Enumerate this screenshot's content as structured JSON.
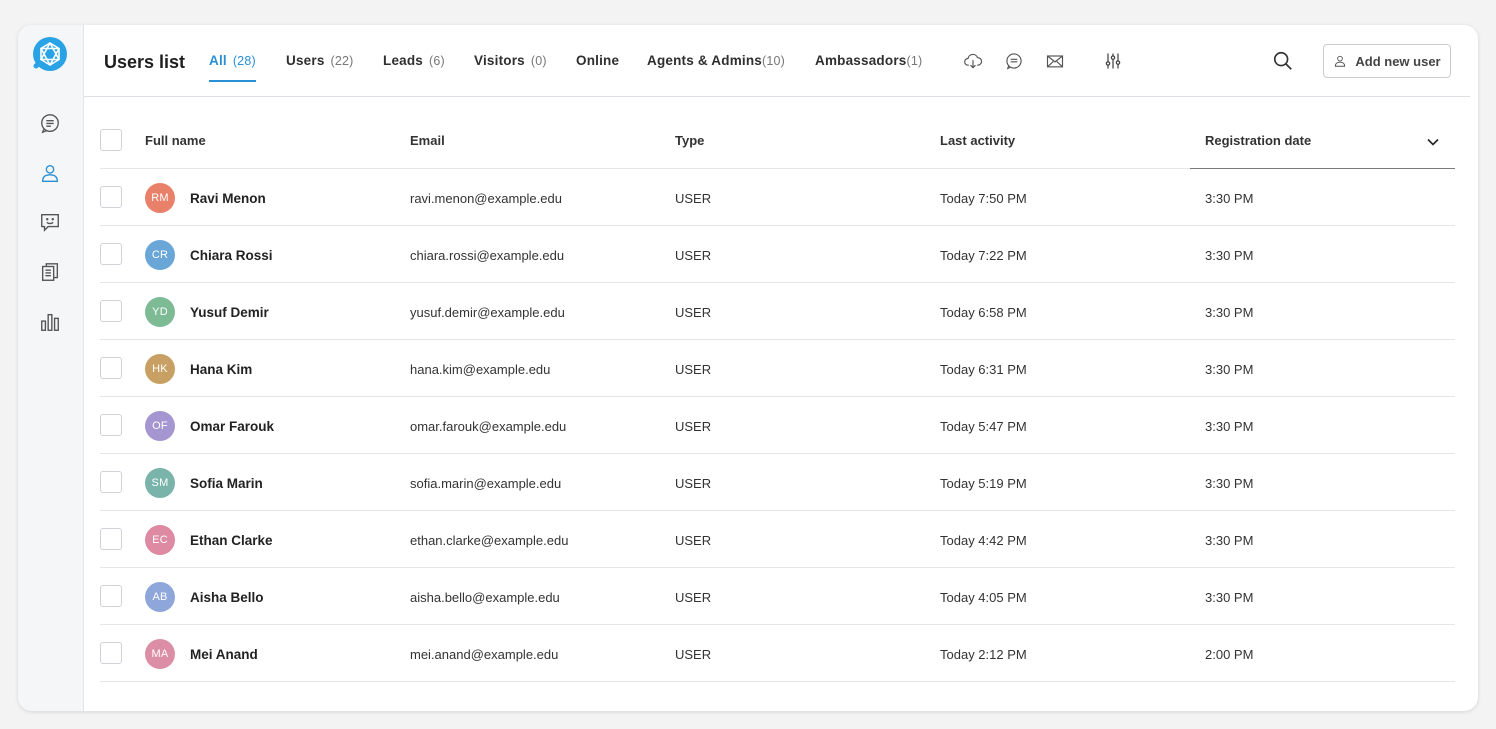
{
  "header": {
    "title": "Users list",
    "tabs": [
      {
        "label": "All",
        "count": "(28)"
      },
      {
        "label": "Users",
        "count": "(22)"
      },
      {
        "label": "Leads",
        "count": "(6)"
      },
      {
        "label": "Visitors",
        "count": "(0)"
      },
      {
        "label": "Online",
        "count": ""
      },
      {
        "label": "Agents & Admins",
        "count": "(10)"
      },
      {
        "label": "Ambassadors",
        "count": "(1)"
      }
    ],
    "add_button_label": "Add new user"
  },
  "table": {
    "columns": [
      "Full name",
      "Email",
      "Type",
      "Last activity",
      "Registration date"
    ],
    "rows": [
      {
        "initials": "RM",
        "name": "Ravi Menon",
        "email": "ravi.menon@example.edu",
        "type": "USER",
        "last_activity": "Today 7:50 PM",
        "registration": "3:30 PM",
        "color": "#e8806a"
      },
      {
        "initials": "CR",
        "name": "Chiara Rossi",
        "email": "chiara.rossi@example.edu",
        "type": "USER",
        "last_activity": "Today 7:22 PM",
        "registration": "3:30 PM",
        "color": "#6aa6d8"
      },
      {
        "initials": "YD",
        "name": "Yusuf Demir",
        "email": "yusuf.demir@example.edu",
        "type": "USER",
        "last_activity": "Today 6:58 PM",
        "registration": "3:30 PM",
        "color": "#7dbb94"
      },
      {
        "initials": "HK",
        "name": "Hana Kim",
        "email": "hana.kim@example.edu",
        "type": "USER",
        "last_activity": "Today 6:31 PM",
        "registration": "3:30 PM",
        "color": "#c9a063"
      },
      {
        "initials": "OF",
        "name": "Omar Farouk",
        "email": "omar.farouk@example.edu",
        "type": "USER",
        "last_activity": "Today 5:47 PM",
        "registration": "3:30 PM",
        "color": "#a596d2"
      },
      {
        "initials": "SM",
        "name": "Sofia Marin",
        "email": "sofia.marin@example.edu",
        "type": "USER",
        "last_activity": "Today 5:19 PM",
        "registration": "3:30 PM",
        "color": "#79b3aa"
      },
      {
        "initials": "EC",
        "name": "Ethan Clarke",
        "email": "ethan.clarke@example.edu",
        "type": "USER",
        "last_activity": "Today 4:42 PM",
        "registration": "3:30 PM",
        "color": "#dd8aa2"
      },
      {
        "initials": "AB",
        "name": "Aisha Bello",
        "email": "aisha.bello@example.edu",
        "type": "USER",
        "last_activity": "Today 4:05 PM",
        "registration": "3:30 PM",
        "color": "#8fa6db"
      },
      {
        "initials": "MA",
        "name": "Mei Anand",
        "email": "mei.anand@example.edu",
        "type": "USER",
        "last_activity": "Today 2:12 PM",
        "registration": "2:00 PM",
        "color": "#dc8ea6"
      }
    ]
  },
  "sidebar": {
    "items": [
      "chat-icon",
      "user-icon",
      "feedback-icon",
      "documents-icon",
      "analytics-icon"
    ]
  },
  "colors": {
    "accent": "#2a8fd4",
    "logo": "#29a3e6"
  }
}
